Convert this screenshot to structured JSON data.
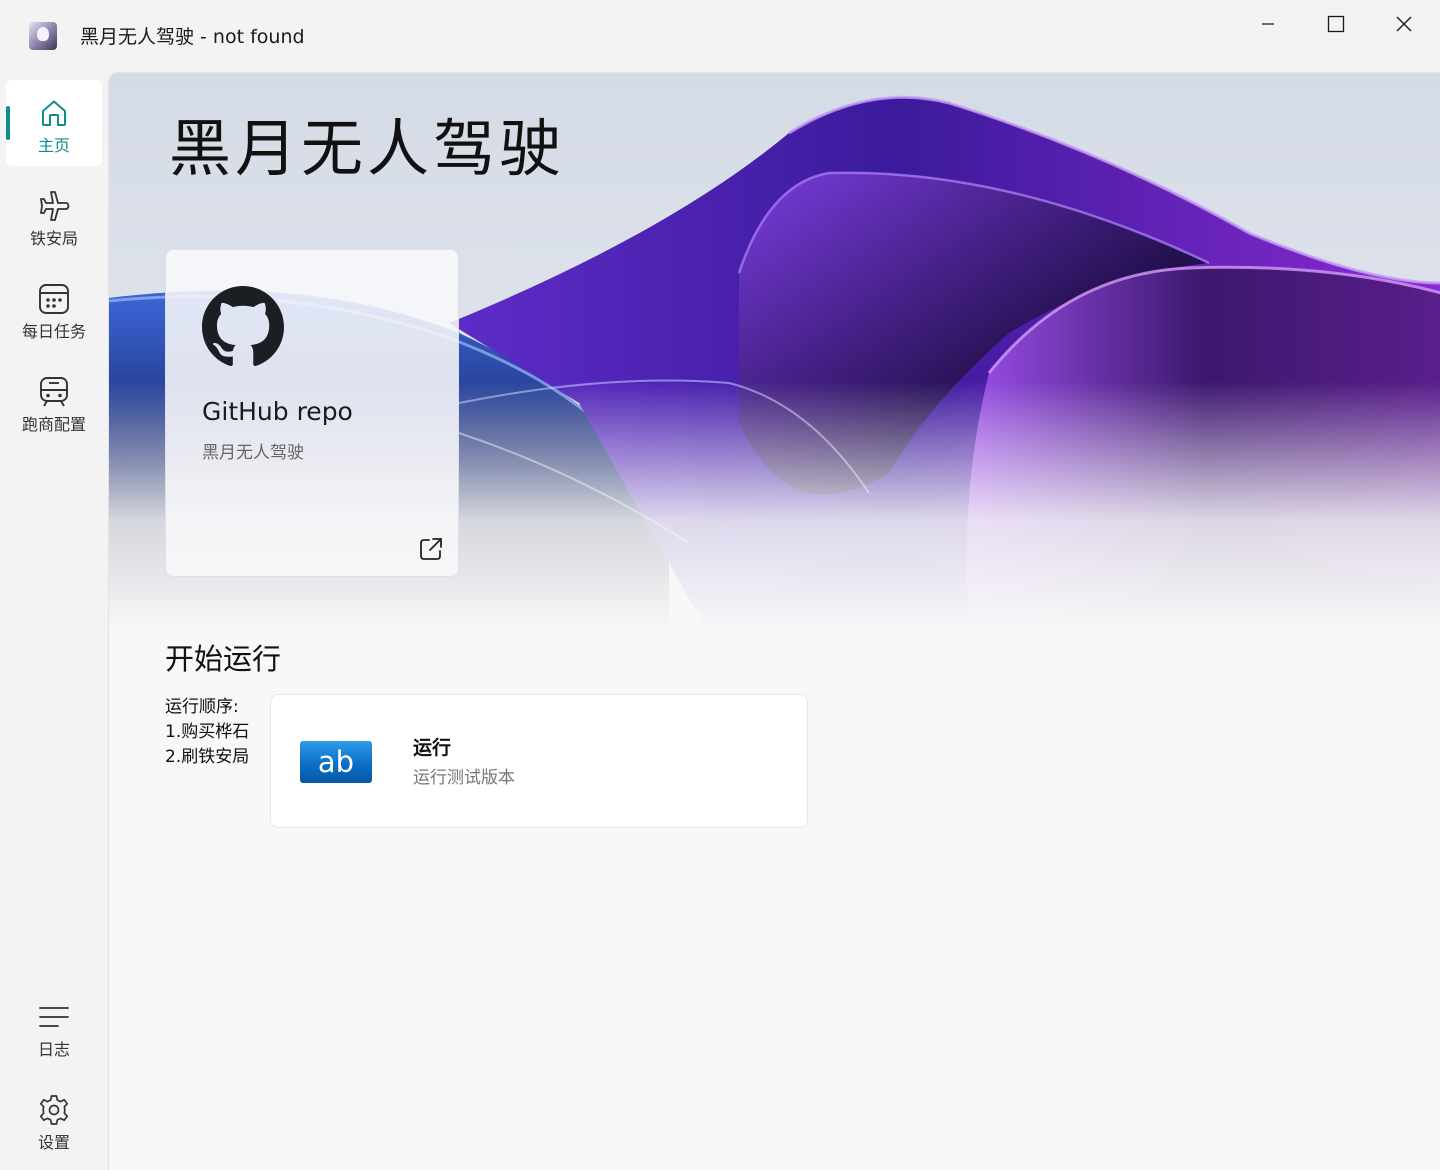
{
  "window": {
    "title": "黑月无人驾驶 - not found"
  },
  "sidebar": {
    "items": [
      {
        "label": "主页",
        "icon": "home-icon",
        "active": true
      },
      {
        "label": "铁安局",
        "icon": "airplane-icon",
        "active": false
      },
      {
        "label": "每日任务",
        "icon": "calendar-icon",
        "active": false
      },
      {
        "label": "跑商配置",
        "icon": "train-icon",
        "active": false
      }
    ],
    "footer_items": [
      {
        "label": "日志",
        "icon": "menu-lines-icon"
      },
      {
        "label": "设置",
        "icon": "gear-icon"
      }
    ],
    "accent_color": "#0f8c8c"
  },
  "hero": {
    "title": "黑月无人驾驶"
  },
  "repo_card": {
    "title": "GitHub repo",
    "subtitle": "黑月无人驾驶",
    "icon": "github-icon",
    "link_icon": "external-link-icon"
  },
  "run_section": {
    "title": "开始运行",
    "order_lines": [
      "运行顺序:",
      "1.购买桦石",
      "2.刷铁安局"
    ],
    "card": {
      "icon_text": "ab",
      "title": "运行",
      "subtitle": "运行测试版本"
    }
  }
}
